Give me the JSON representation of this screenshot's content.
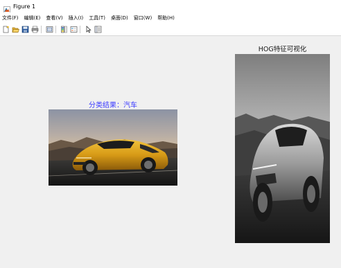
{
  "window": {
    "title": "Figure 1"
  },
  "menubar": {
    "items": [
      {
        "label": "文件(F)"
      },
      {
        "label": "编辑(E)"
      },
      {
        "label": "查看(V)"
      },
      {
        "label": "插入(I)"
      },
      {
        "label": "工具(T)"
      },
      {
        "label": "桌面(D)"
      },
      {
        "label": "窗口(W)"
      },
      {
        "label": "帮助(H)"
      }
    ]
  },
  "toolbar": {
    "buttons": [
      {
        "icon": "new-figure-icon"
      },
      {
        "icon": "open-file-icon"
      },
      {
        "icon": "save-icon"
      },
      {
        "icon": "print-icon"
      },
      {
        "icon": "link-plot-icon"
      },
      {
        "icon": "colorbar-icon"
      },
      {
        "icon": "legend-icon"
      },
      {
        "icon": "edit-plot-arrow-icon"
      },
      {
        "icon": "property-inspector-icon"
      }
    ]
  },
  "figure": {
    "left_axes": {
      "title": "分类结果：汽车",
      "title_color": "#3b3bff",
      "image": "yellow-sports-car-photo"
    },
    "right_axes": {
      "title": "HOG特征可视化",
      "title_color": "#1a1a1a",
      "image": "grayscale-hog-car-image"
    }
  }
}
